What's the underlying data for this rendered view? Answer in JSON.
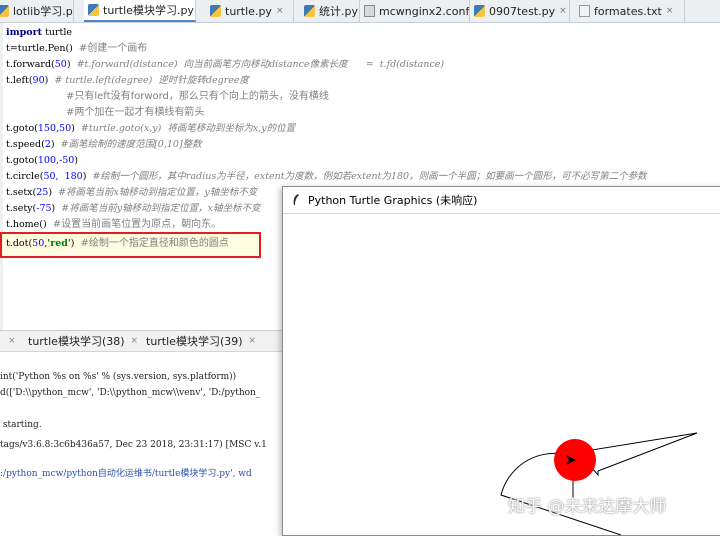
{
  "tabs": [
    {
      "label": "lotlib学习.py",
      "icon": "python-file-icon",
      "active": false
    },
    {
      "label": "turtle模块学习.py",
      "icon": "python-file-icon",
      "active": true
    },
    {
      "label": "turtle.py",
      "icon": "python-file-icon",
      "active": false
    },
    {
      "label": "统计.py",
      "icon": "python-file-icon",
      "active": false
    },
    {
      "label": "mcwnginx2.conf",
      "icon": "config-file-icon",
      "active": false
    },
    {
      "label": "0907test.py",
      "icon": "python-file-icon",
      "active": false
    },
    {
      "label": "formates.txt",
      "icon": "text-file-icon",
      "active": false
    }
  ],
  "close_glyph": "×",
  "code": {
    "l1": {
      "kw": "import",
      "rest": " turtle"
    },
    "l2": {
      "code": "t=turtle.Pen()  ",
      "comment": "#创建一个画布"
    },
    "l3": {
      "code": "t.forward(",
      "num": "50",
      "close": ")  ",
      "comment": "#t.forward(distance)  向当前画笔方向移动distance像素长度      =  t.fd(distance)"
    },
    "l4": {
      "code": "t.left(",
      "num": "90",
      "close": ")  ",
      "comment": "# turtle.left(degree)  逆时针旋转degree度"
    },
    "l5": {
      "comment": "#只有left没有forword，那么只有个向上的箭头，没有横线"
    },
    "l6": {
      "comment": "#两个加在一起才有横线有箭头"
    },
    "l7": {
      "code": "t.goto(",
      "num": "150,50",
      "close": ")  ",
      "comment": "#turtle.goto(x,y)  将画笔移动到坐标为x,y的位置"
    },
    "l8": {
      "code": "t.speed(",
      "num": "2",
      "close": ")  ",
      "comment": "#画笔绘制的速度范围[0,10]整数"
    },
    "l9": {
      "code": "t.goto(",
      "num": "100,-50",
      "close": ")",
      "comment": ""
    },
    "l10": {
      "code": "t.circle(",
      "num": "50,  180",
      "close": ")  ",
      "comment": "#绘制一个圆形，其中radius为半径，extent为度数，例如若extent为180，则画一个半圆；如要画一个圆形，可不必写第二个参数"
    },
    "l11": {
      "code": "t.setx(",
      "num": "25",
      "close": ")  ",
      "comment": "#将画笔当前x轴移动到指定位置，y轴坐标不变"
    },
    "l12": {
      "code": "t.sety(",
      "num": "-75",
      "close": ")  ",
      "comment": "#将画笔当前y轴移动到指定位置，x轴坐标不变"
    },
    "l13": {
      "code": "t.home()  ",
      "comment": "#设置当前画笔位置为原点，朝向东。"
    },
    "l14": {
      "code": "t.dot(",
      "num": "50,",
      "str": "'red'",
      "close": ")  ",
      "comment": "#绘制一个指定直径和颜色的圆点"
    }
  },
  "run_tabs": [
    {
      "label": "turtle模块学习(38)"
    },
    {
      "label": "turtle模块学习(39)"
    }
  ],
  "console_lines": [
    "int('Python %s on %s' % (sys.version, sys.platform))",
    "d(['D:\\\\python_mcw', 'D:\\\\python_mcw\\\\venv', 'D:/python_",
    "",
    " starting.",
    "",
    "tags/v3.6.8:3c6b436a57, Dec 23 2018, 23:31:17) [MSC v.1",
    ":/python_mcw/python自动化运维书/turtle模块学习.py', wd"
  ],
  "turtle_window": {
    "title": "Python Turtle Graphics (未响应)",
    "dot_color": "#ff0000"
  },
  "watermark": "知乎 @未来达摩大师"
}
